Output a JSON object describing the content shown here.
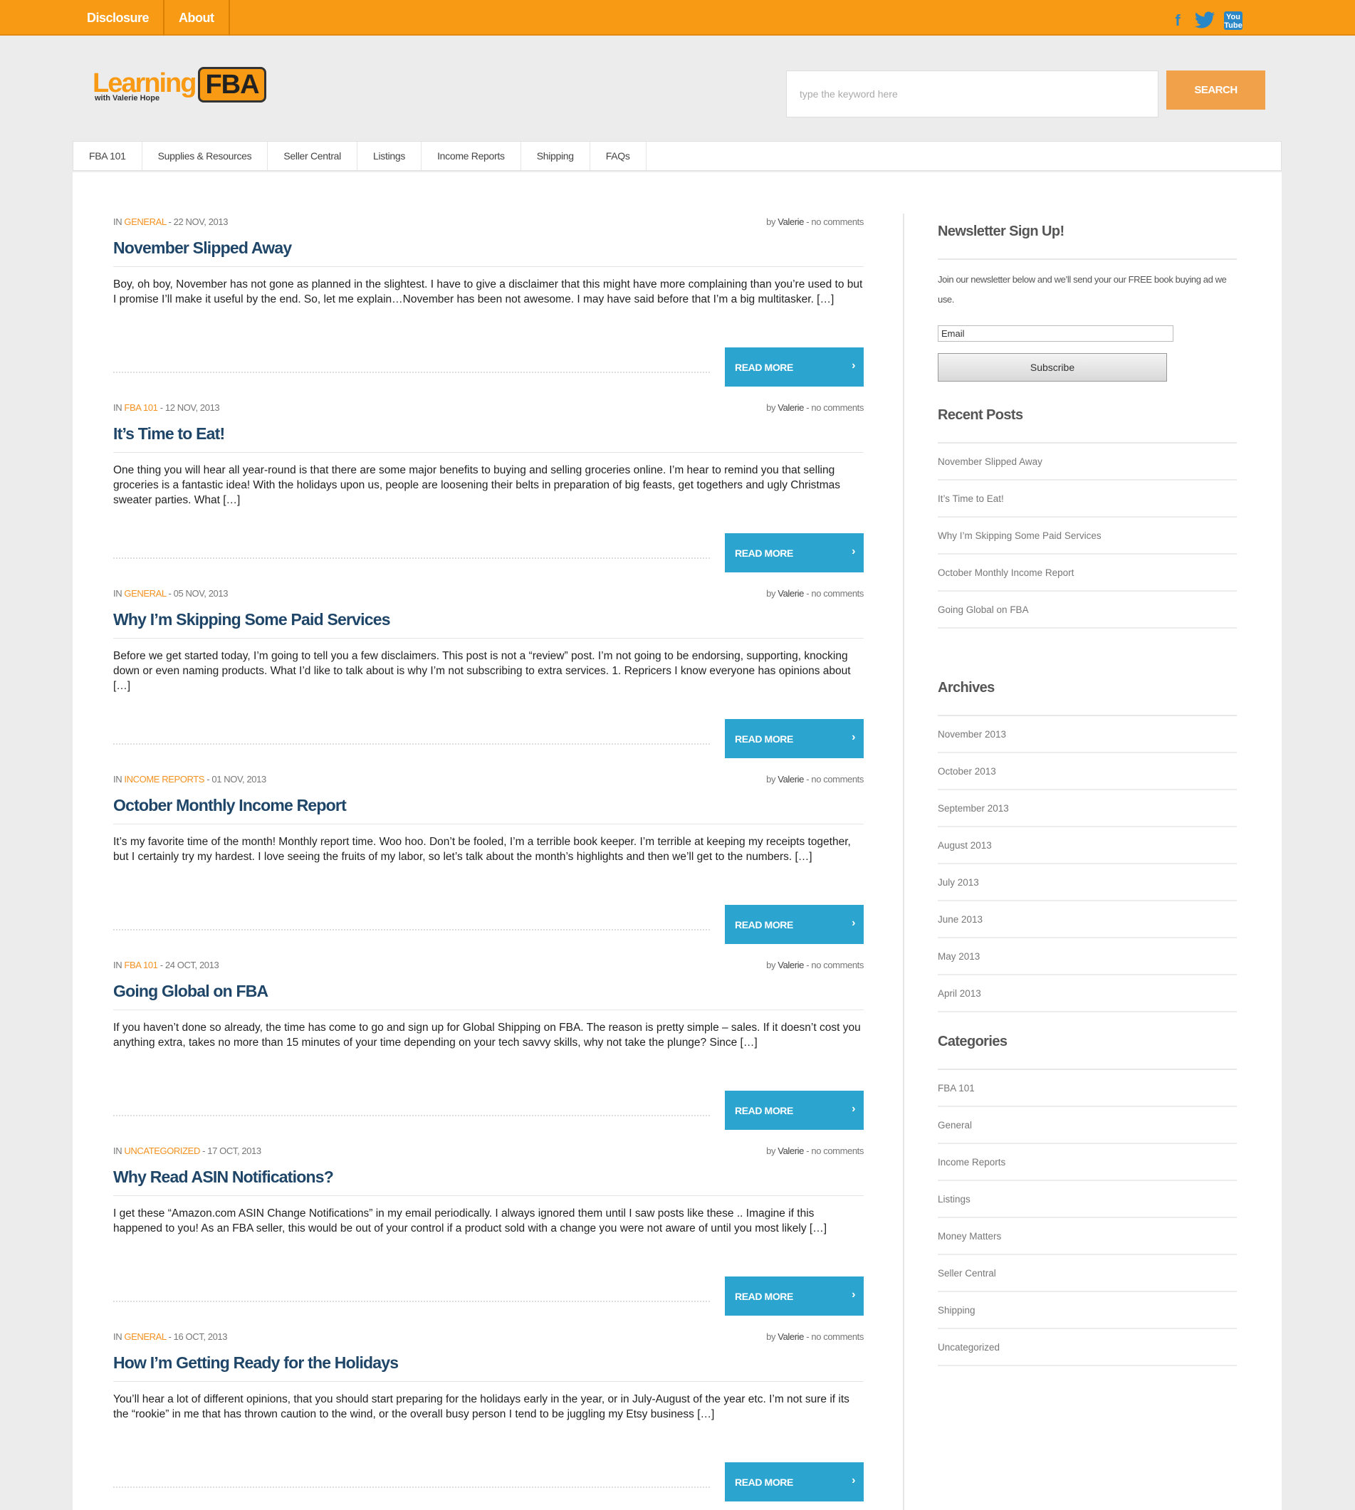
{
  "topnav": [
    "Disclosure",
    "About"
  ],
  "social": {
    "facebook": "f",
    "twitter": "t",
    "youtube": "You Tube"
  },
  "logo": {
    "main": "Learning",
    "badge": "FBA",
    "tagline": "with Valerie Hope"
  },
  "search": {
    "placeholder": "type the keyword here",
    "button": "SEARCH"
  },
  "mainnav": [
    "FBA 101",
    "Supplies & Resources",
    "Seller Central",
    "Listings",
    "Income Reports",
    "Shipping",
    "FAQs"
  ],
  "posts": [
    {
      "in": "IN",
      "category": "GENERAL",
      "date": "- 22 NOV, 2013",
      "by": "by",
      "author": "Valerie",
      "comments": "- no comments",
      "title": "November Slipped Away",
      "excerpt": "Boy, oh boy, November has not gone as planned in the slightest. I have to give a disclaimer that this might have more complaining than you’re used to but I promise I’ll make it useful by the end. So, let me explain…November has been not awesome. I may have said before that I’m a big multitasker. […]",
      "read_more": "READ MORE"
    },
    {
      "in": "IN",
      "category": "FBA 101",
      "date": "- 12 NOV, 2013",
      "by": "by",
      "author": "Valerie",
      "comments": "- no comments",
      "title": "It’s Time to Eat!",
      "excerpt": "One thing you will hear all year-round is that there are some major benefits to buying and selling groceries online. I’m hear to remind you that selling groceries is a fantastic idea! With the holidays upon us, people are loosening their belts in preparation of big feasts, get togethers and ugly Christmas sweater parties. What […]",
      "read_more": "READ MORE"
    },
    {
      "in": "IN",
      "category": "GENERAL",
      "date": "- 05 NOV, 2013",
      "by": "by",
      "author": "Valerie",
      "comments": "- no comments",
      "title": "Why I’m Skipping Some Paid Services",
      "excerpt": "Before we get started today, I’m going to tell you a few disclaimers. This post is not a “review” post. I’m not going to be endorsing, supporting, knocking down or even naming products. What I’d like to talk about is why I’m not subscribing to extra services. 1. Repricers I know everyone has opinions about […]",
      "read_more": "READ MORE"
    },
    {
      "in": "IN",
      "category": "INCOME REPORTS",
      "date": "- 01 NOV, 2013",
      "by": "by",
      "author": "Valerie",
      "comments": "- no comments",
      "title": "October Monthly Income Report",
      "excerpt": "It’s my favorite time of the month! Monthly report time. Woo hoo. Don’t be fooled, I’m a terrible book keeper. I’m terrible at keeping my receipts together, but I certainly try my hardest. I love seeing the fruits of my labor, so let’s talk about the month’s highlights and then we’ll get to the numbers. […]",
      "read_more": "READ MORE"
    },
    {
      "in": "IN",
      "category": "FBA 101",
      "date": "- 24 OCT, 2013",
      "by": "by",
      "author": "Valerie",
      "comments": "- no comments",
      "title": "Going Global on FBA",
      "excerpt": "If you haven’t done so already, the time has come to go and sign up for Global Shipping on FBA. The reason is pretty simple – sales. If it doesn’t cost you anything extra, takes no more than 15 minutes of your time depending on your tech savvy skills, why not take the plunge? Since […]",
      "read_more": "READ MORE"
    },
    {
      "in": "IN",
      "category": "UNCATEGORIZED",
      "date": "- 17 OCT, 2013",
      "by": "by",
      "author": "Valerie",
      "comments": "- no comments",
      "title": "Why Read ASIN Notifications?",
      "excerpt": "I get these “Amazon.com ASIN Change Notifications” in my email periodically. I always ignored them until I saw posts like these .. Imagine if this happened to you! As an FBA seller, this would be out of your control if a product sold with a change you were not aware of until you most likely […]",
      "read_more": "READ MORE"
    },
    {
      "in": "IN",
      "category": "GENERAL",
      "date": "- 16 OCT, 2013",
      "by": "by",
      "author": "Valerie",
      "comments": "- no comments",
      "title": "How I’m Getting Ready for the Holidays",
      "excerpt": "You’ll hear a lot of different opinions, that you should start preparing for the holidays early in the year, or in July-August of the year etc. I’m not sure if its the “rookie” in me that has thrown caution to the wind, or the overall busy person I tend to be juggling my Etsy business […]",
      "read_more": "READ MORE"
    }
  ],
  "sidebar": {
    "newsletter": {
      "title": "Newsletter Sign Up!",
      "text": "Join our newsletter below and we’ll send your our FREE book buying ad we use.",
      "email_value": "Email",
      "subscribe": "Subscribe"
    },
    "recent": {
      "title": "Recent Posts",
      "items": [
        "November Slipped Away",
        "It’s Time to Eat!",
        "Why I’m Skipping Some Paid Services",
        "October Monthly Income Report",
        "Going Global on FBA"
      ]
    },
    "archives": {
      "title": "Archives",
      "items": [
        "November 2013",
        "October 2013",
        "September 2013",
        "August 2013",
        "July 2013",
        "June 2013",
        "May 2013",
        "April 2013"
      ]
    },
    "categories": {
      "title": "Categories",
      "items": [
        "FBA 101",
        "General",
        "Income Reports",
        "Listings",
        "Money Matters",
        "Seller Central",
        "Shipping",
        "Uncategorized"
      ]
    }
  },
  "colors": {
    "accent": "#f89a14",
    "button": "#2ba4cf",
    "title": "#1f4668"
  }
}
